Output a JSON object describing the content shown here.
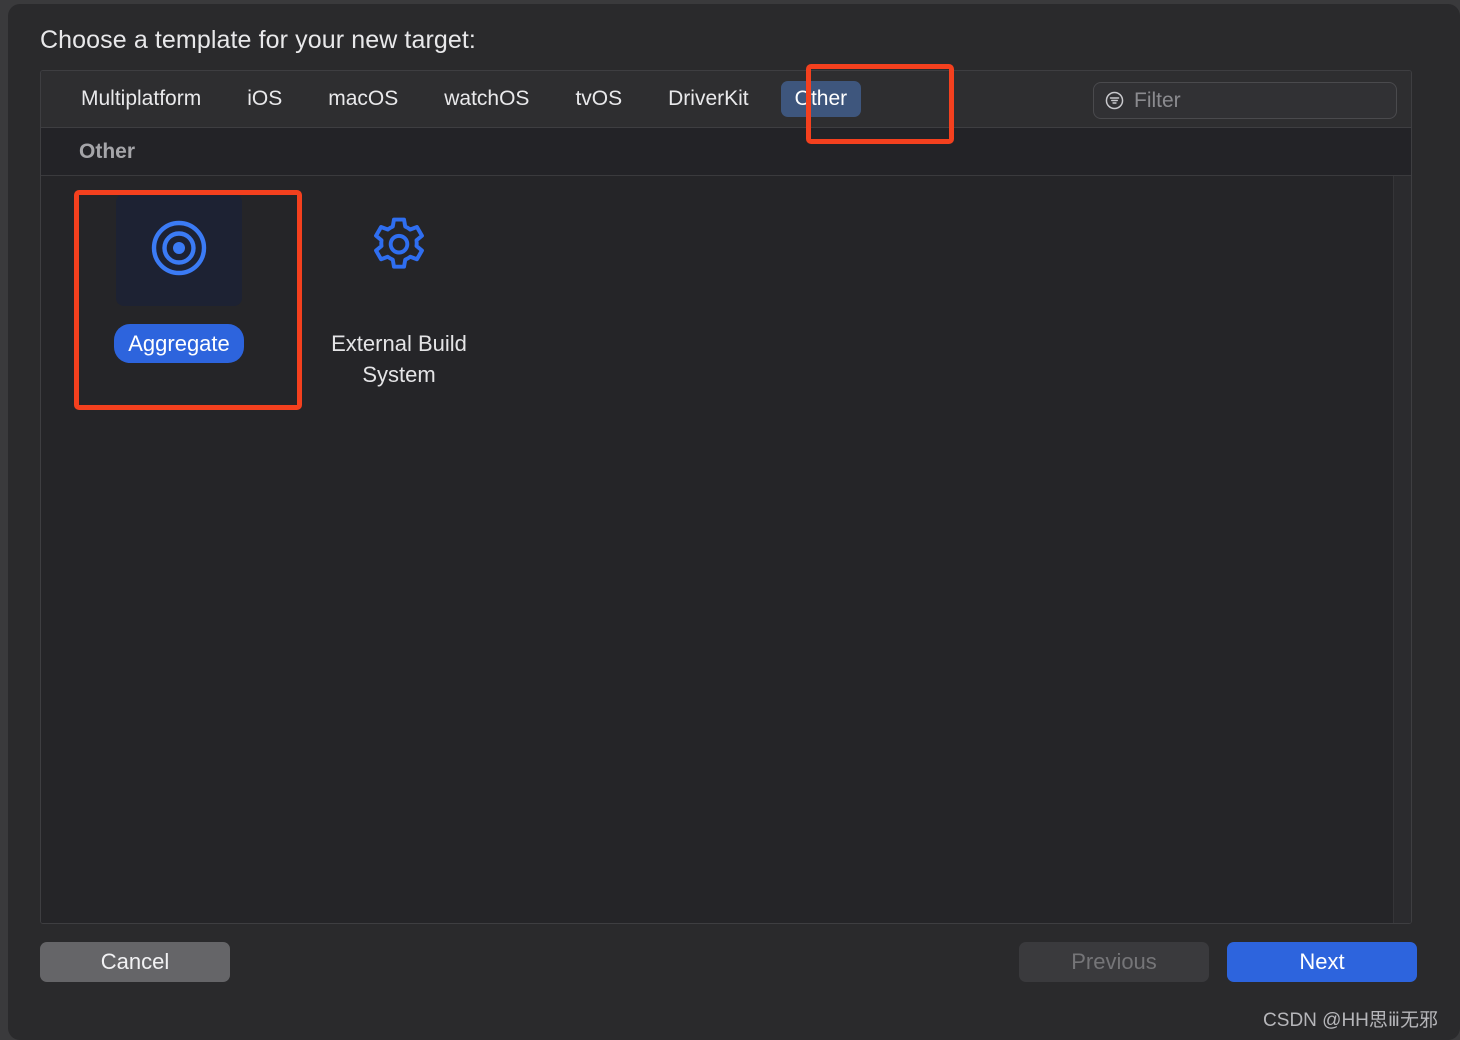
{
  "dialog": {
    "title": "Choose a template for your new target:"
  },
  "tabs": [
    {
      "label": "Multiplatform",
      "selected": false
    },
    {
      "label": "iOS",
      "selected": false
    },
    {
      "label": "macOS",
      "selected": false
    },
    {
      "label": "watchOS",
      "selected": false
    },
    {
      "label": "tvOS",
      "selected": false
    },
    {
      "label": "DriverKit",
      "selected": false
    },
    {
      "label": "Other",
      "selected": true
    }
  ],
  "filter": {
    "placeholder": "Filter",
    "value": "",
    "icon": "filter-icon"
  },
  "section": {
    "header": "Other"
  },
  "templates": [
    {
      "label": "Aggregate",
      "icon": "target-icon",
      "selected": true
    },
    {
      "label": "External Build System",
      "icon": "gear-icon",
      "selected": false
    }
  ],
  "footer": {
    "cancel_label": "Cancel",
    "previous_label": "Previous",
    "next_label": "Next"
  },
  "watermark": "CSDN @HH思ⅲ无邪",
  "colors": {
    "accent_blue": "#2d64dd",
    "tab_selected": "#3e567d",
    "annotation_red": "#f4401e",
    "thumb_navy": "#1d2233",
    "dialog_bg": "#2a2a2c"
  }
}
